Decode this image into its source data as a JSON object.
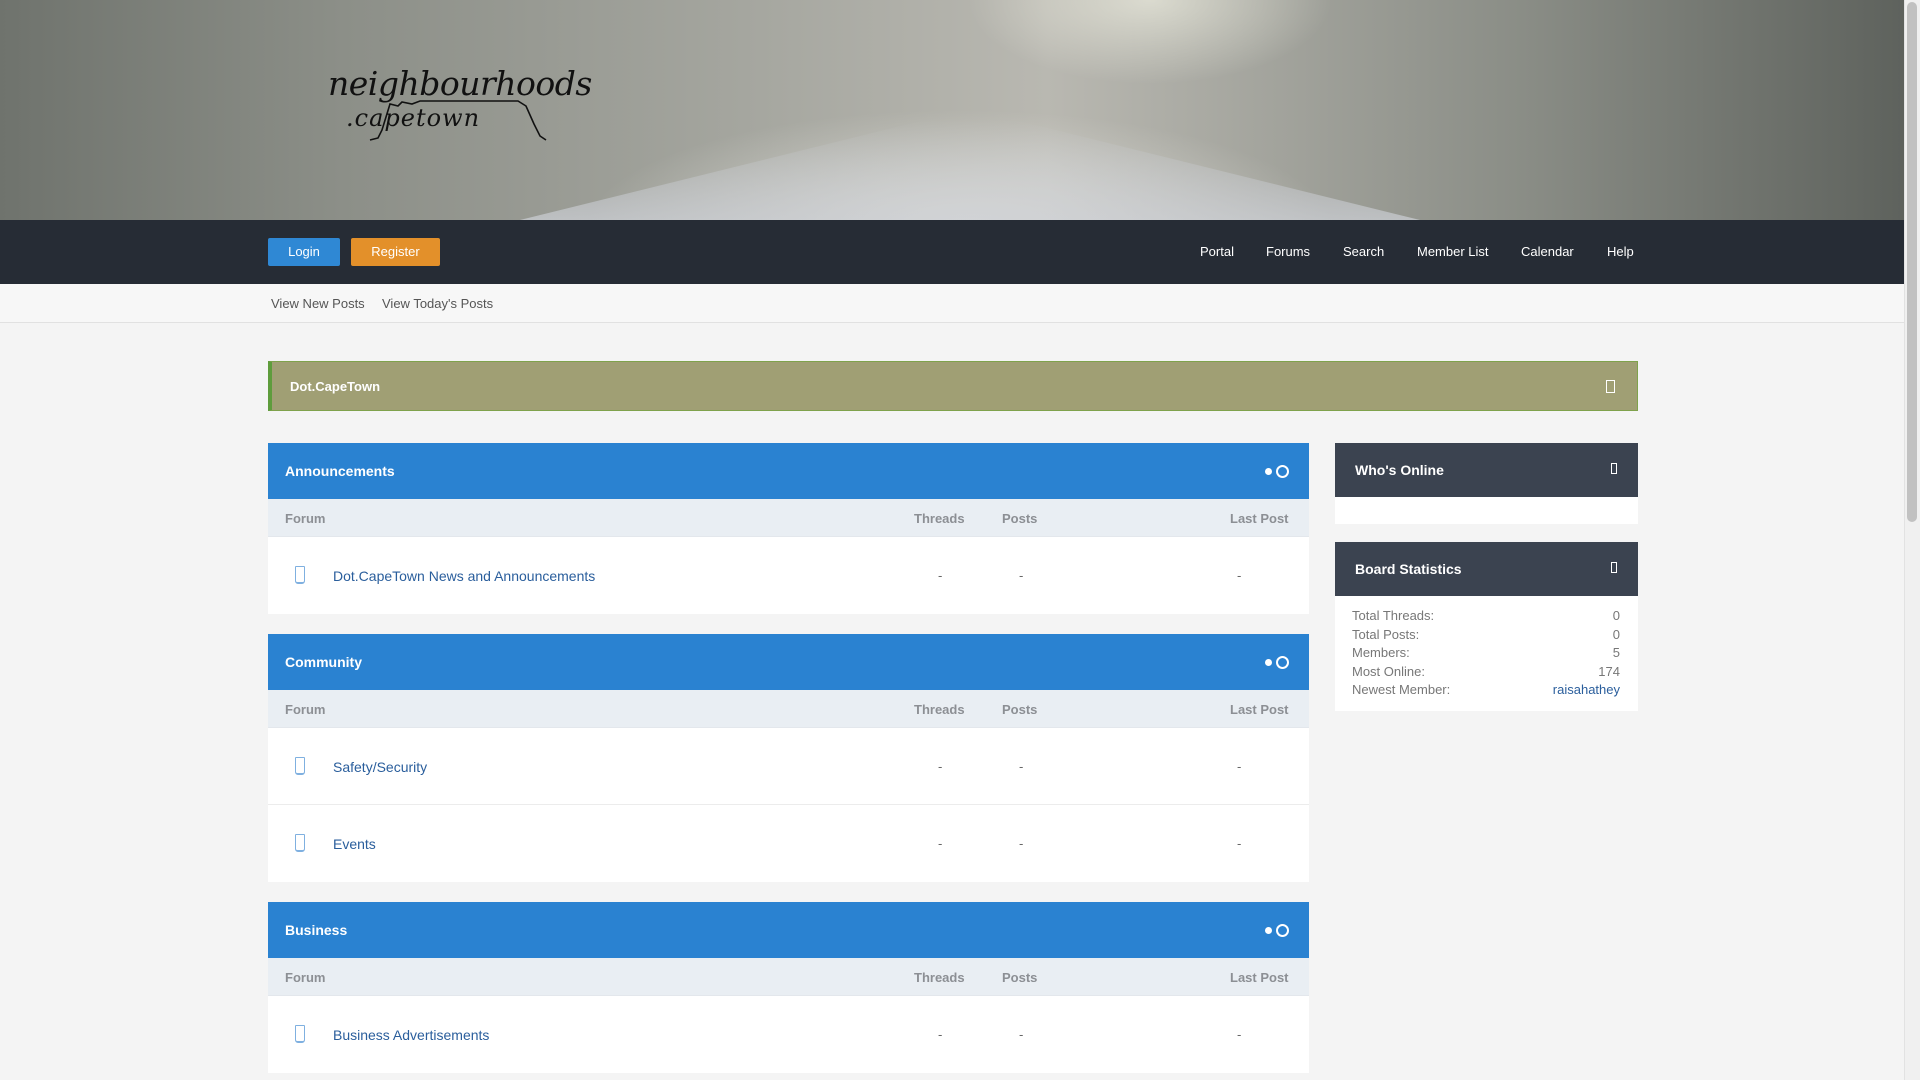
{
  "header": {
    "logo_line1": "neighbourhoods",
    "logo_line2": ".capetown"
  },
  "nav": {
    "login": "Login",
    "register": "Register",
    "links": [
      "Portal",
      "Forums",
      "Search",
      "Member List",
      "Calendar",
      "Help"
    ]
  },
  "subnav": {
    "new_posts": "View New Posts",
    "todays_posts": "View Today's Posts"
  },
  "notice": {
    "title": "Dot.CapeTown"
  },
  "columns": {
    "forum": "Forum",
    "threads": "Threads",
    "posts": "Posts",
    "last_post": "Last Post"
  },
  "categories": [
    {
      "title": "Announcements",
      "forums": [
        {
          "name": "Dot.CapeTown News and Announcements",
          "threads": "-",
          "posts": "-",
          "last_post": "-"
        }
      ]
    },
    {
      "title": "Community",
      "forums": [
        {
          "name": "Safety/Security",
          "threads": "-",
          "posts": "-",
          "last_post": "-"
        },
        {
          "name": "Events",
          "threads": "-",
          "posts": "-",
          "last_post": "-"
        }
      ]
    },
    {
      "title": "Business",
      "forums": [
        {
          "name": "Business Advertisements",
          "threads": "-",
          "posts": "-",
          "last_post": "-"
        }
      ]
    }
  ],
  "sidebar": {
    "whos_online": "Who's Online",
    "board_stats": "Board Statistics",
    "stats": [
      {
        "label": "Total Threads:",
        "value": "0"
      },
      {
        "label": "Total Posts:",
        "value": "0"
      },
      {
        "label": "Members:",
        "value": "5"
      },
      {
        "label": "Most Online:",
        "value": "174"
      },
      {
        "label": "Newest Member:",
        "value": "raisahathey"
      }
    ]
  },
  "colors": {
    "category_header": "#2a82d1",
    "navbar": "#262c35",
    "login_button": "#2f88d4",
    "register_button": "#e3902a",
    "notice": "#a09f74",
    "sidebar_header": "#3b4350"
  },
  "icons": [
    "close-icon",
    "collapse-toggle-icon",
    "forum-status-icon"
  ]
}
